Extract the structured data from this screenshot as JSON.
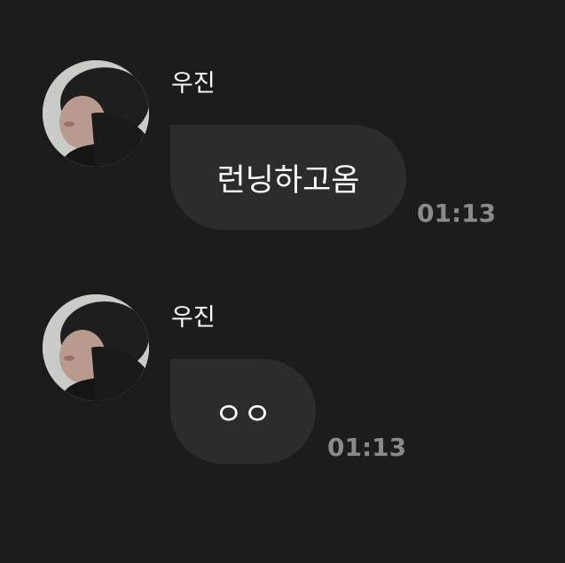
{
  "messages": [
    {
      "sender": "우진",
      "text": "런닝하고옴",
      "time": "01:13"
    },
    {
      "sender": "우진",
      "text": "ㅇㅇ",
      "time": "01:13"
    }
  ]
}
